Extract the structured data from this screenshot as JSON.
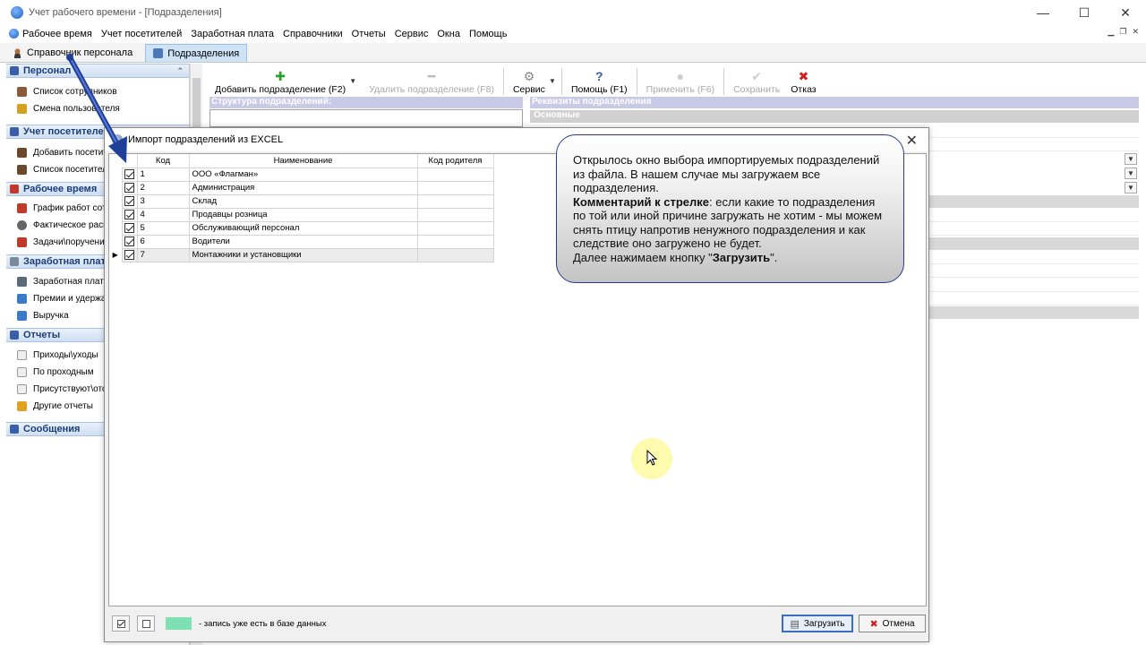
{
  "window": {
    "title": "Учет рабочего времени - [Подразделения]"
  },
  "menu": {
    "items": [
      "Рабочее время",
      "Учет посетителей",
      "Заработная плата",
      "Справочники",
      "Отчеты",
      "Сервис",
      "Окна",
      "Помощь"
    ]
  },
  "tabs": [
    "Справочник персонала",
    "Подразделения"
  ],
  "nav": {
    "groups": [
      {
        "label": "Персонал",
        "items": [
          "Список сотрудников",
          "Смена пользователя"
        ]
      },
      {
        "label": "Учет посетителей",
        "items": [
          "Добавить посетителя",
          "Список посетителей"
        ]
      },
      {
        "label": "Рабочее время",
        "items": [
          "График работ сотр",
          "Фактическое расп",
          "Задачи\\поручения"
        ]
      },
      {
        "label": "Заработная плата",
        "items": [
          "Заработная плата",
          "Премии и удержан",
          "Выручка"
        ]
      },
      {
        "label": "Отчеты",
        "items": [
          "Приходы\\уходы",
          "По проходным",
          "Присутствуют\\отс",
          "Другие отчеты"
        ]
      },
      {
        "label": "Сообщения",
        "items": []
      }
    ]
  },
  "toolbar": {
    "add": "Добавить подразделение (F2)",
    "delete": "Удалить подразделение (F8)",
    "service": "Сервис",
    "help": "Помощь (F1)",
    "apply": "Применить (F6)",
    "save": "Сохранить",
    "cancel": "Отказ"
  },
  "panels": {
    "structure_title": "Структура подразделений:",
    "props_title": "Реквизиты подразделения",
    "props_group": "Основные"
  },
  "dialog": {
    "title": "Импорт подразделений из EXCEL",
    "columns": [
      "Код",
      "Наименование",
      "Код родителя"
    ],
    "rows": [
      {
        "code": "1",
        "name": "ООО «Флагман»",
        "parent": ""
      },
      {
        "code": "2",
        "name": "Администрация",
        "parent": ""
      },
      {
        "code": "3",
        "name": "Склад",
        "parent": ""
      },
      {
        "code": "4",
        "name": "Продавцы розница",
        "parent": ""
      },
      {
        "code": "5",
        "name": "Обслуживающий персонал",
        "parent": ""
      },
      {
        "code": "6",
        "name": "Водители",
        "parent": ""
      },
      {
        "code": "7",
        "name": "Монтажники и установщики",
        "parent": ""
      }
    ],
    "legend": "- запись уже есть в базе данных",
    "legend_color": "#7fe0b4",
    "load_button": "Загрузить",
    "cancel_button": "Отмена"
  },
  "callout": {
    "line1": "Открылось окно выбора импортируемых подразделений из файла. В нашем случае мы загружаем все подразделения.",
    "bold": "Комментарий к стрелке",
    "line2": ": если какие то подразделения по той или иной причине загружать не хотим - мы можем снять птицу напротив ненужного подразделения и как следствие оно загружено не будет.",
    "line3a": "Далее нажимаем кнопку \"",
    "line3b": "Загрузить",
    "line3c": "\"."
  }
}
